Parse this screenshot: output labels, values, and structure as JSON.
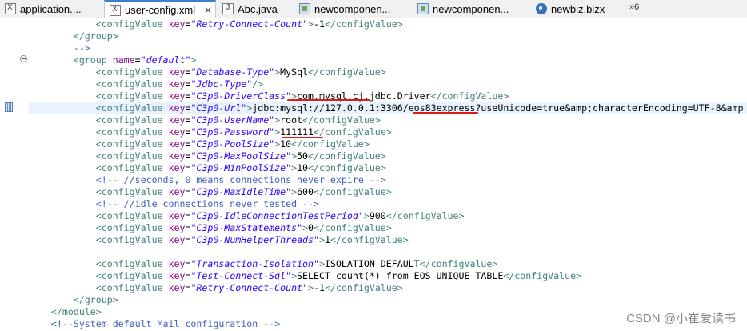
{
  "tabs": [
    {
      "label": "application....",
      "icon": "xml-file-icon",
      "active": false,
      "closable": false
    },
    {
      "label": "user-config.xml",
      "icon": "xml-file-icon",
      "active": true,
      "closable": true,
      "close_glyph": "✕"
    },
    {
      "label": "Abc.java",
      "icon": "java-file-icon",
      "active": false,
      "closable": false
    },
    {
      "label": "newcomponen...",
      "icon": "component-icon",
      "active": false,
      "closable": false
    },
    {
      "label": "newcomponen...",
      "icon": "component-icon",
      "active": false,
      "closable": false
    },
    {
      "label": "newbiz.bizx",
      "icon": "biz-file-icon",
      "active": false,
      "closable": false
    }
  ],
  "overflow_label": "»6",
  "code_lines": [
    "            <configValue key=\"Retry-Connect-Count\">-1</configValue>",
    "        </group>",
    "        -->",
    "        <group name=\"default\">",
    "            <configValue key=\"Database-Type\">MySql</configValue>",
    "            <configValue key=\"Jdbc-Type\"/>",
    "            <configValue key=\"C3p0-DriverClass\">com.mysql.cj.jdbc.Driver</configValue>",
    "            <configValue key=\"C3p0-Url\">jdbc:mysql://127.0.0.1:3306/eos83express?useUnicode=true&amp;characterEncoding=UTF-8&amp",
    "            <configValue key=\"C3p0-UserName\">root</configValue>",
    "            <configValue key=\"C3p0-Password\">111111</configValue>",
    "            <configValue key=\"C3p0-PoolSize\">10</configValue>",
    "            <configValue key=\"C3p0-MaxPoolSize\">50</configValue>",
    "            <configValue key=\"C3p0-MinPoolSize\">10</configValue>",
    "            <!-- //seconds, 0 means connections never expire -->",
    "            <configValue key=\"C3p0-MaxIdleTime\">600</configValue>",
    "            <!-- //idle connections never tested -->",
    "            <configValue key=\"C3p0-IdleConnectionTestPeriod\">900</configValue>",
    "            <configValue key=\"C3p0-MaxStatements\">0</configValue>",
    "            <configValue key=\"C3p0-NumHelperThreads\">1</configValue>",
    "",
    "            <configValue key=\"Transaction-Isolation\">ISOLATION_DEFAULT</configValue>",
    "            <configValue key=\"Test-Connect-Sql\">SELECT count(*) from EOS_UNIQUE_TABLE</configValue>",
    "            <configValue key=\"Retry-Connect-Count\">-1</configValue>",
    "        </group>",
    "    </module>",
    "    <!--System default Mail configuration -->"
  ],
  "current_line_index": 7,
  "watermark": "CSDN @小崔爱读书",
  "colors": {
    "tag": "#3f7f7f",
    "attribute": "#7f007f",
    "attribute_value": "#2a00ff",
    "comment": "#3f5fbf",
    "annotation_underline": "#e01818",
    "current_line": "#e8f2fe"
  }
}
